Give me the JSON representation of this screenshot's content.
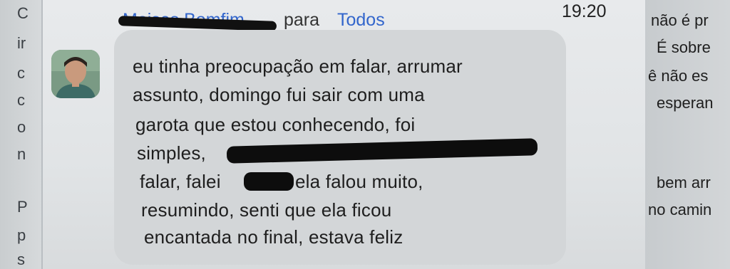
{
  "left_column": {
    "letters": [
      "C",
      "ir",
      "c",
      "c",
      "o",
      "n",
      "P",
      "p",
      "s"
    ]
  },
  "message": {
    "sender_name": "Moises Bomfim",
    "to_label": "para",
    "recipient": "Todos",
    "time": "19:20",
    "lines": [
      "eu tinha preocupação em falar, arrumar",
      "assunto, domingo fui sair com uma",
      "garota que estou conhecendo, foi",
      "simples,",
      "falar, falei",
      "ela falou muito,",
      "resumindo, senti que ela ficou",
      "encantada no final, estava feliz"
    ]
  },
  "right_column": {
    "snippets": [
      "não é pr",
      "É sobre",
      "ê não es",
      "esperan",
      "bem arr",
      "no camin"
    ]
  }
}
